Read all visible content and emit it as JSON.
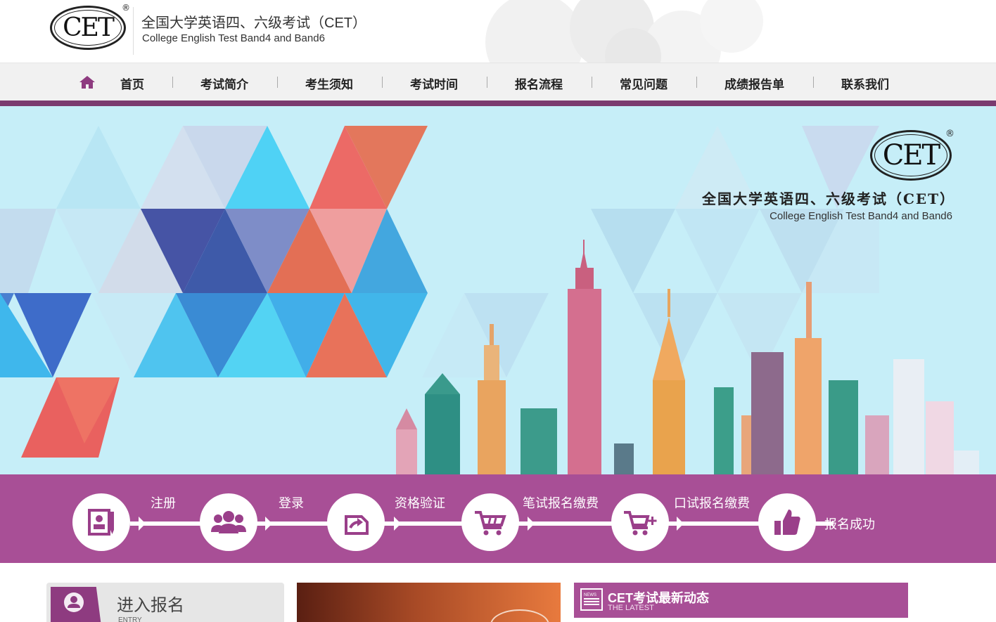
{
  "header": {
    "logo_text": "CET",
    "logo_reg": "®",
    "title_cn": "全国大学英语四、六级考试（CET）",
    "title_en": "College English Test Band4 and Band6"
  },
  "nav": {
    "items": [
      {
        "label": "首页"
      },
      {
        "label": "考试简介"
      },
      {
        "label": "考生须知"
      },
      {
        "label": "考试时间"
      },
      {
        "label": "报名流程"
      },
      {
        "label": "常见问题"
      },
      {
        "label": "成绩报告单"
      },
      {
        "label": "联系我们"
      }
    ]
  },
  "banner": {
    "logo_text": "CET",
    "logo_reg": "®",
    "title_cn": "全国大学英语四、六级考试（CET）",
    "title_en": "College English Test Band4 and Band6"
  },
  "process": {
    "steps": [
      {
        "label": "注册",
        "icon": "register-icon"
      },
      {
        "label": "登录",
        "icon": "users-icon"
      },
      {
        "label": "资格验证",
        "icon": "verify-icon"
      },
      {
        "label": "笔试报名缴费",
        "icon": "cart-icon"
      },
      {
        "label": "口试报名缴费",
        "icon": "cart-plus-icon"
      },
      {
        "label": "报名成功",
        "icon": "thumbs-up-icon"
      }
    ]
  },
  "entry": {
    "title": "进入报名",
    "subtitle": "ENTRY",
    "icon": "user-icon"
  },
  "news": {
    "title": "CET考试最新动态",
    "subtitle": "THE LATEST",
    "icon_text": "NEWS"
  },
  "colors": {
    "brand_purple": "#a84f96",
    "nav_bar_accent": "#7a3a6f",
    "banner_sky": "#c6eef8"
  }
}
